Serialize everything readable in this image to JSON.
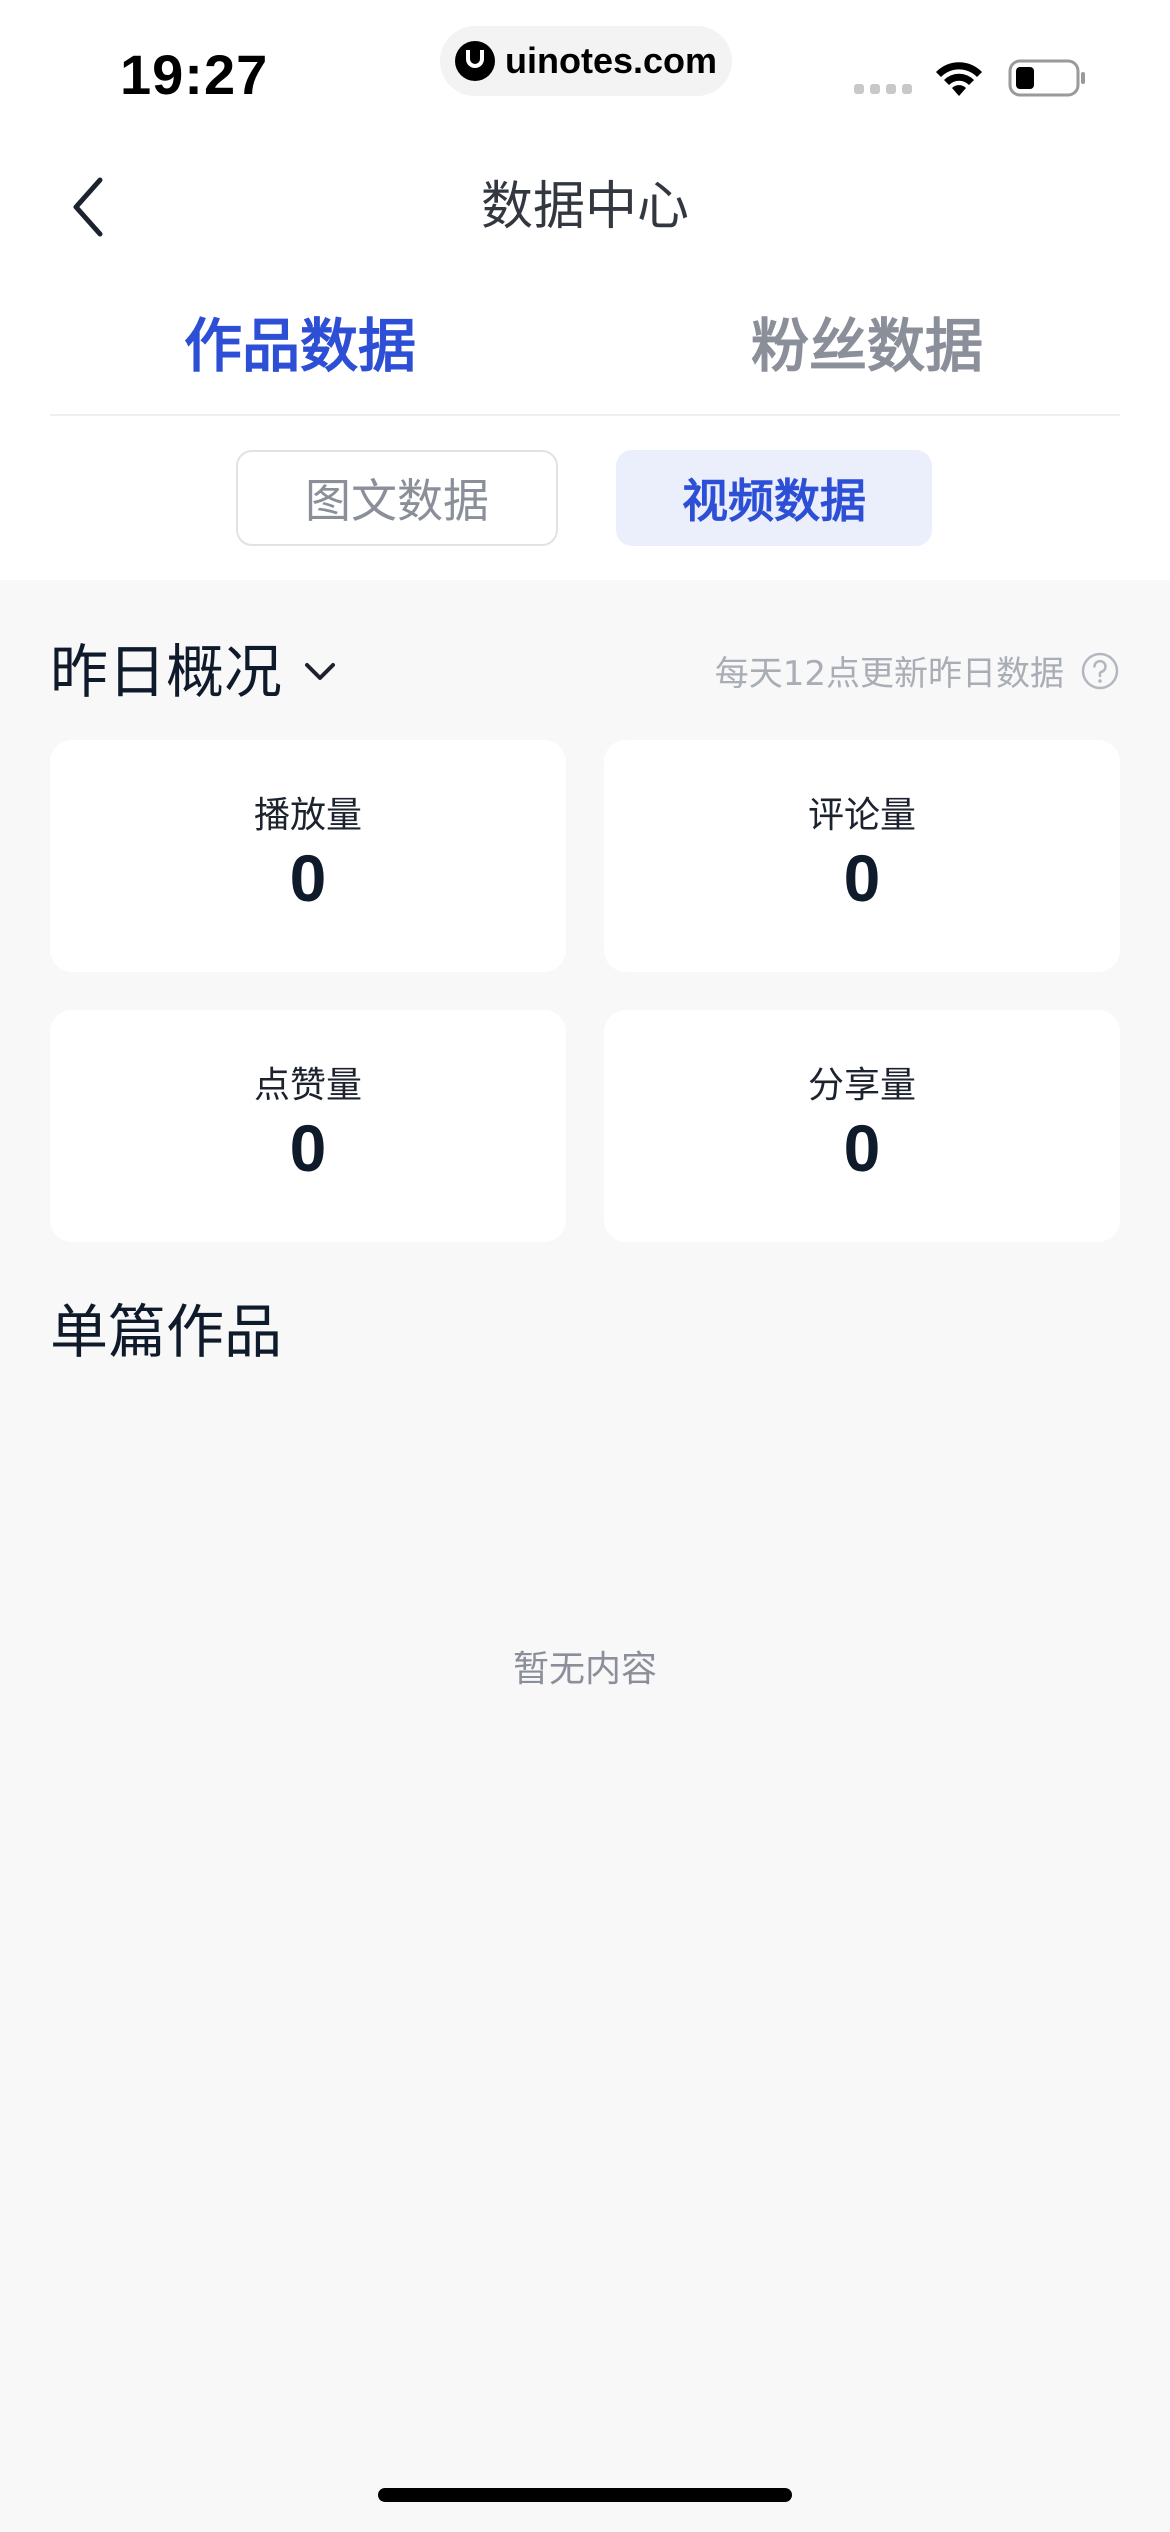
{
  "status_bar": {
    "time": "19:27",
    "url": "uinotes.com"
  },
  "nav": {
    "title": "数据中心"
  },
  "main_tabs": [
    {
      "label": "作品数据",
      "active": true
    },
    {
      "label": "粉丝数据",
      "active": false
    }
  ],
  "sub_tabs": [
    {
      "label": "图文数据",
      "active": false
    },
    {
      "label": "视频数据",
      "active": true
    }
  ],
  "overview": {
    "title": "昨日概况",
    "note": "每天12点更新昨日数据",
    "stats": [
      {
        "label": "播放量",
        "value": "0"
      },
      {
        "label": "评论量",
        "value": "0"
      },
      {
        "label": "点赞量",
        "value": "0"
      },
      {
        "label": "分享量",
        "value": "0"
      }
    ]
  },
  "single_works": {
    "title": "单篇作品",
    "empty_text": "暂无内容"
  },
  "colors": {
    "accent": "#2d4fd6",
    "accent_bg": "#ebeffc",
    "muted": "#8a8f99",
    "page_bg": "#f8f8f8"
  }
}
